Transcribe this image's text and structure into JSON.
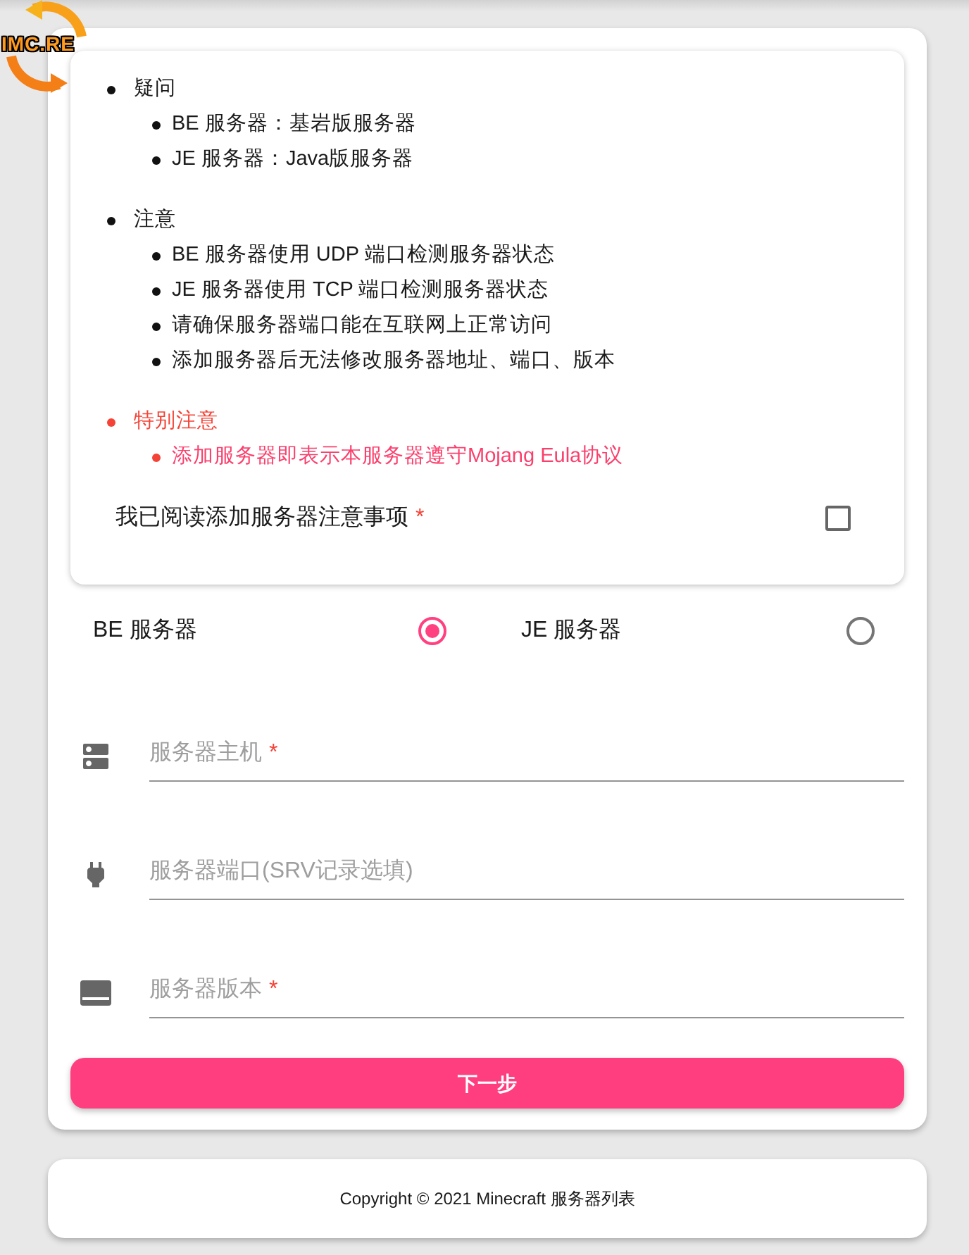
{
  "logo": {
    "text": "IMC.RE"
  },
  "notice": [
    {
      "kind": "info",
      "title": "疑问",
      "items": [
        "BE 服务器：基岩版服务器",
        "JE 服务器：Java版服务器"
      ]
    },
    {
      "kind": "info",
      "title": "注意",
      "items": [
        "BE 服务器使用 UDP 端口检测服务器状态",
        "JE 服务器使用 TCP 端口检测服务器状态",
        "请确保服务器端口能在互联网上正常访问",
        "添加服务器后无法修改服务器地址、端口、版本"
      ]
    },
    {
      "kind": "warning",
      "title": "特别注意",
      "items": [
        "添加服务器即表示本服务器遵守Mojang Eula协议"
      ]
    }
  ],
  "agreement": {
    "label": "我已阅读添加服务器注意事项",
    "required_mark": "*",
    "checked": false
  },
  "server_type": [
    {
      "label": "BE 服务器",
      "selected": true
    },
    {
      "label": "JE 服务器",
      "selected": false
    }
  ],
  "fields": [
    {
      "kind": "host",
      "label": "服务器主机",
      "required_mark": "*"
    },
    {
      "kind": "port",
      "label": "服务器端口(SRV记录选填)"
    },
    {
      "kind": "version",
      "label": "服务器版本",
      "required_mark": "*"
    }
  ],
  "next_button": {
    "label": "下一步"
  },
  "footer": {
    "text": "Copyright © 2021 Minecraft 服务器列表"
  }
}
